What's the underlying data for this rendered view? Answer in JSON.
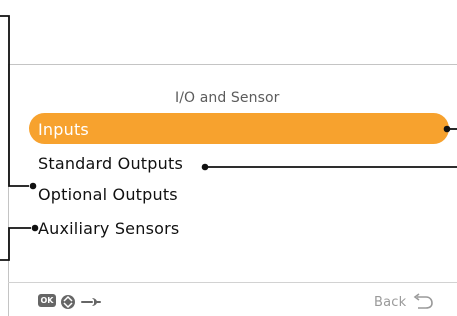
{
  "screen": {
    "title": "I/O and Sensor",
    "menu": [
      {
        "label": "Inputs",
        "selected": true
      },
      {
        "label": "Standard Outputs",
        "selected": false
      },
      {
        "label": "Optional Outputs",
        "selected": false
      },
      {
        "label": "Auxiliary Sensors",
        "selected": false
      }
    ],
    "footer": {
      "ok_label": "OK",
      "back_label": "Back"
    },
    "colors": {
      "accent": "#f7a22e",
      "text": "#111111",
      "muted": "#9a9a9a"
    },
    "icons": [
      "ok-icon",
      "updown-icon",
      "wrench-icon",
      "back-icon"
    ]
  }
}
